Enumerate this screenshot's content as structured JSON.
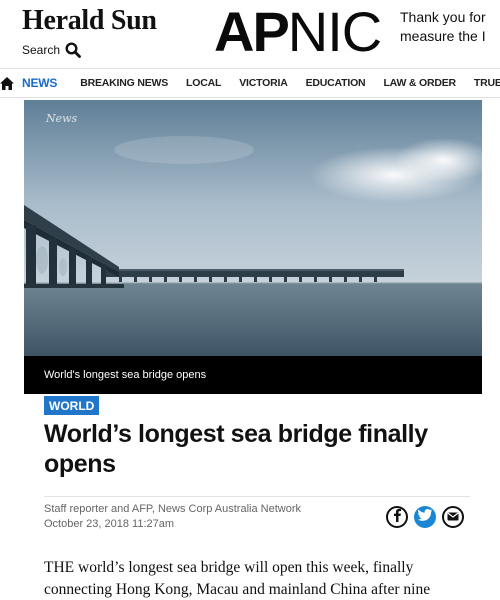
{
  "header": {
    "site_title": "Herald Sun",
    "search_label": "Search",
    "ad": {
      "brand_bold": "AP",
      "brand_light": "NIC",
      "message": "Thank you for",
      "message_line2": "measure the I"
    }
  },
  "nav": {
    "home_icon": "home-icon",
    "items": [
      {
        "label": "NEWS",
        "active": true
      },
      {
        "label": "BREAKING NEWS",
        "active": false
      },
      {
        "label": "LOCAL",
        "active": false
      },
      {
        "label": "VICTORIA",
        "active": false
      },
      {
        "label": "EDUCATION",
        "active": false
      },
      {
        "label": "LAW & ORDER",
        "active": false
      },
      {
        "label": "TRUE C",
        "active": false
      }
    ],
    "active_color": "#1a6cc7"
  },
  "hero": {
    "watermark": "News",
    "caption": "World's longest sea bridge opens"
  },
  "article": {
    "category": "WORLD",
    "category_color": "#2276c9",
    "headline": "World’s longest sea bridge finally opens",
    "byline": "Staff reporter and AFP, News Corp Australia Network",
    "date": "October 23, 2018 11:27am",
    "share_icons": [
      "facebook-icon",
      "twitter-icon",
      "email-icon"
    ],
    "body": "THE world’s longest sea bridge will open this week, finally connecting Hong Kong, Macau and mainland China after nine"
  }
}
